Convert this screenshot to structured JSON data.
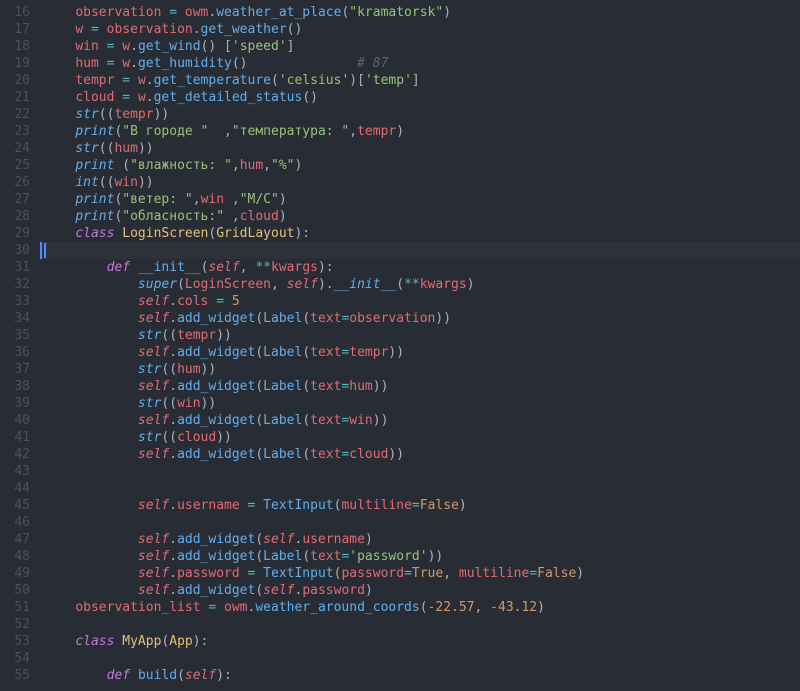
{
  "first_line": 16,
  "highlighted_line": 30,
  "lines": [
    [
      [
        "p",
        "    "
      ],
      [
        "id",
        "observation"
      ],
      [
        "p",
        " "
      ],
      [
        "op",
        "="
      ],
      [
        "p",
        " "
      ],
      [
        "id",
        "owm"
      ],
      [
        "p",
        "."
      ],
      [
        "fn",
        "weather_at_place"
      ],
      [
        "p",
        "("
      ],
      [
        "s",
        "\"kramatorsk\""
      ],
      [
        "p",
        ")"
      ]
    ],
    [
      [
        "p",
        "    "
      ],
      [
        "id",
        "w"
      ],
      [
        "p",
        " "
      ],
      [
        "op",
        "="
      ],
      [
        "p",
        " "
      ],
      [
        "id",
        "observation"
      ],
      [
        "p",
        "."
      ],
      [
        "fn",
        "get_weather"
      ],
      [
        "p",
        "()"
      ]
    ],
    [
      [
        "p",
        "    "
      ],
      [
        "id",
        "win"
      ],
      [
        "p",
        " "
      ],
      [
        "op",
        "="
      ],
      [
        "p",
        " "
      ],
      [
        "id",
        "w"
      ],
      [
        "p",
        "."
      ],
      [
        "fn",
        "get_wind"
      ],
      [
        "p",
        "() ["
      ],
      [
        "s",
        "'speed'"
      ],
      [
        "p",
        "]"
      ]
    ],
    [
      [
        "p",
        "    "
      ],
      [
        "id",
        "hum"
      ],
      [
        "p",
        " "
      ],
      [
        "op",
        "="
      ],
      [
        "p",
        " "
      ],
      [
        "id",
        "w"
      ],
      [
        "p",
        "."
      ],
      [
        "fn",
        "get_humidity"
      ],
      [
        "p",
        "()              "
      ],
      [
        "cm",
        "# 87"
      ]
    ],
    [
      [
        "p",
        "    "
      ],
      [
        "id",
        "tempr"
      ],
      [
        "p",
        " "
      ],
      [
        "op",
        "="
      ],
      [
        "p",
        " "
      ],
      [
        "id",
        "w"
      ],
      [
        "p",
        "."
      ],
      [
        "fn",
        "get_temperature"
      ],
      [
        "p",
        "("
      ],
      [
        "s",
        "'celsius'"
      ],
      [
        "p",
        ")["
      ],
      [
        "s",
        "'temp'"
      ],
      [
        "p",
        "]"
      ]
    ],
    [
      [
        "p",
        "    "
      ],
      [
        "id",
        "cloud"
      ],
      [
        "p",
        " "
      ],
      [
        "op",
        "="
      ],
      [
        "p",
        " "
      ],
      [
        "id",
        "w"
      ],
      [
        "p",
        "."
      ],
      [
        "fn",
        "get_detailed_status"
      ],
      [
        "p",
        "()"
      ]
    ],
    [
      [
        "p",
        "    "
      ],
      [
        "fi",
        "str"
      ],
      [
        "p",
        "(("
      ],
      [
        "id",
        "tempr"
      ],
      [
        "p",
        "))"
      ]
    ],
    [
      [
        "p",
        "    "
      ],
      [
        "fi",
        "print"
      ],
      [
        "p",
        "("
      ],
      [
        "s",
        "\"В городе \"  "
      ],
      [
        "p",
        ","
      ],
      [
        "s",
        "\"температура: \""
      ],
      [
        "p",
        ","
      ],
      [
        "id",
        "tempr"
      ],
      [
        "p",
        ")"
      ]
    ],
    [
      [
        "p",
        "    "
      ],
      [
        "fi",
        "str"
      ],
      [
        "p",
        "(("
      ],
      [
        "id",
        "hum"
      ],
      [
        "p",
        "))"
      ]
    ],
    [
      [
        "p",
        "    "
      ],
      [
        "fi",
        "print"
      ],
      [
        "p",
        " ("
      ],
      [
        "s",
        "\"влажность: \""
      ],
      [
        "p",
        ","
      ],
      [
        "id",
        "hum"
      ],
      [
        "p",
        ","
      ],
      [
        "s",
        "\"%\""
      ],
      [
        "p",
        ")"
      ]
    ],
    [
      [
        "p",
        "    "
      ],
      [
        "fi",
        "int"
      ],
      [
        "p",
        "(("
      ],
      [
        "id",
        "win"
      ],
      [
        "p",
        "))"
      ]
    ],
    [
      [
        "p",
        "    "
      ],
      [
        "fi",
        "print"
      ],
      [
        "p",
        "("
      ],
      [
        "s",
        "\"ветер: \""
      ],
      [
        "p",
        ","
      ],
      [
        "id",
        "win"
      ],
      [
        "p",
        " ,"
      ],
      [
        "s",
        "\"М/С\""
      ],
      [
        "p",
        ")"
      ]
    ],
    [
      [
        "p",
        "    "
      ],
      [
        "fi",
        "print"
      ],
      [
        "p",
        "("
      ],
      [
        "s",
        "\"обласность:\""
      ],
      [
        "p",
        " ,"
      ],
      [
        "id",
        "cloud"
      ],
      [
        "p",
        ")"
      ]
    ],
    [
      [
        "p",
        "    "
      ],
      [
        "k",
        "class"
      ],
      [
        "p",
        " "
      ],
      [
        "cl",
        "LoginScreen"
      ],
      [
        "p",
        "("
      ],
      [
        "cl",
        "GridLayout"
      ],
      [
        "p",
        "):"
      ]
    ],
    [],
    [
      [
        "p",
        "        "
      ],
      [
        "k",
        "def"
      ],
      [
        "p",
        " "
      ],
      [
        "fn",
        "__init__"
      ],
      [
        "p",
        "("
      ],
      [
        "sf",
        "self"
      ],
      [
        "p",
        ", "
      ],
      [
        "op",
        "**"
      ],
      [
        "id",
        "kwargs"
      ],
      [
        "p",
        "):"
      ]
    ],
    [
      [
        "p",
        "            "
      ],
      [
        "fi",
        "super"
      ],
      [
        "p",
        "("
      ],
      [
        "id",
        "LoginScreen"
      ],
      [
        "p",
        ", "
      ],
      [
        "sf",
        "self"
      ],
      [
        "p",
        ")."
      ],
      [
        "fi",
        "__init__"
      ],
      [
        "p",
        "("
      ],
      [
        "op",
        "**"
      ],
      [
        "id",
        "kwargs"
      ],
      [
        "p",
        ")"
      ]
    ],
    [
      [
        "p",
        "            "
      ],
      [
        "sf",
        "self"
      ],
      [
        "p",
        "."
      ],
      [
        "id",
        "cols"
      ],
      [
        "p",
        " "
      ],
      [
        "op",
        "="
      ],
      [
        "p",
        " "
      ],
      [
        "n",
        "5"
      ]
    ],
    [
      [
        "p",
        "            "
      ],
      [
        "sf",
        "self"
      ],
      [
        "p",
        "."
      ],
      [
        "fn",
        "add_widget"
      ],
      [
        "p",
        "("
      ],
      [
        "fn",
        "Label"
      ],
      [
        "p",
        "("
      ],
      [
        "id",
        "text"
      ],
      [
        "op",
        "="
      ],
      [
        "id",
        "observation"
      ],
      [
        "p",
        "))"
      ]
    ],
    [
      [
        "p",
        "            "
      ],
      [
        "fi",
        "str"
      ],
      [
        "p",
        "(("
      ],
      [
        "id",
        "tempr"
      ],
      [
        "p",
        "))"
      ]
    ],
    [
      [
        "p",
        "            "
      ],
      [
        "sf",
        "self"
      ],
      [
        "p",
        "."
      ],
      [
        "fn",
        "add_widget"
      ],
      [
        "p",
        "("
      ],
      [
        "fn",
        "Label"
      ],
      [
        "p",
        "("
      ],
      [
        "id",
        "text"
      ],
      [
        "op",
        "="
      ],
      [
        "id",
        "tempr"
      ],
      [
        "p",
        "))"
      ]
    ],
    [
      [
        "p",
        "            "
      ],
      [
        "fi",
        "str"
      ],
      [
        "p",
        "(("
      ],
      [
        "id",
        "hum"
      ],
      [
        "p",
        "))"
      ]
    ],
    [
      [
        "p",
        "            "
      ],
      [
        "sf",
        "self"
      ],
      [
        "p",
        "."
      ],
      [
        "fn",
        "add_widget"
      ],
      [
        "p",
        "("
      ],
      [
        "fn",
        "Label"
      ],
      [
        "p",
        "("
      ],
      [
        "id",
        "text"
      ],
      [
        "op",
        "="
      ],
      [
        "id",
        "hum"
      ],
      [
        "p",
        "))"
      ]
    ],
    [
      [
        "p",
        "            "
      ],
      [
        "fi",
        "str"
      ],
      [
        "p",
        "(("
      ],
      [
        "id",
        "win"
      ],
      [
        "p",
        "))"
      ]
    ],
    [
      [
        "p",
        "            "
      ],
      [
        "sf",
        "self"
      ],
      [
        "p",
        "."
      ],
      [
        "fn",
        "add_widget"
      ],
      [
        "p",
        "("
      ],
      [
        "fn",
        "Label"
      ],
      [
        "p",
        "("
      ],
      [
        "id",
        "text"
      ],
      [
        "op",
        "="
      ],
      [
        "id",
        "win"
      ],
      [
        "p",
        "))"
      ]
    ],
    [
      [
        "p",
        "            "
      ],
      [
        "fi",
        "str"
      ],
      [
        "p",
        "(("
      ],
      [
        "id",
        "cloud"
      ],
      [
        "p",
        "))"
      ]
    ],
    [
      [
        "p",
        "            "
      ],
      [
        "sf",
        "self"
      ],
      [
        "p",
        "."
      ],
      [
        "fn",
        "add_widget"
      ],
      [
        "p",
        "("
      ],
      [
        "fn",
        "Label"
      ],
      [
        "p",
        "("
      ],
      [
        "id",
        "text"
      ],
      [
        "op",
        "="
      ],
      [
        "id",
        "cloud"
      ],
      [
        "p",
        "))"
      ]
    ],
    [],
    [],
    [
      [
        "p",
        "            "
      ],
      [
        "sf",
        "self"
      ],
      [
        "p",
        "."
      ],
      [
        "id",
        "username"
      ],
      [
        "p",
        " "
      ],
      [
        "op",
        "="
      ],
      [
        "p",
        " "
      ],
      [
        "fn",
        "TextInput"
      ],
      [
        "p",
        "("
      ],
      [
        "id",
        "multiline"
      ],
      [
        "op",
        "="
      ],
      [
        "co",
        "False"
      ],
      [
        "p",
        ")"
      ]
    ],
    [],
    [
      [
        "p",
        "            "
      ],
      [
        "sf",
        "self"
      ],
      [
        "p",
        "."
      ],
      [
        "fn",
        "add_widget"
      ],
      [
        "p",
        "("
      ],
      [
        "sf",
        "self"
      ],
      [
        "p",
        "."
      ],
      [
        "id",
        "username"
      ],
      [
        "p",
        ")"
      ]
    ],
    [
      [
        "p",
        "            "
      ],
      [
        "sf",
        "self"
      ],
      [
        "p",
        "."
      ],
      [
        "fn",
        "add_widget"
      ],
      [
        "p",
        "("
      ],
      [
        "fn",
        "Label"
      ],
      [
        "p",
        "("
      ],
      [
        "id",
        "text"
      ],
      [
        "op",
        "="
      ],
      [
        "s",
        "'password'"
      ],
      [
        "p",
        "))"
      ]
    ],
    [
      [
        "p",
        "            "
      ],
      [
        "sf",
        "self"
      ],
      [
        "p",
        "."
      ],
      [
        "id",
        "password"
      ],
      [
        "p",
        " "
      ],
      [
        "op",
        "="
      ],
      [
        "p",
        " "
      ],
      [
        "fn",
        "TextInput"
      ],
      [
        "p",
        "("
      ],
      [
        "id",
        "password"
      ],
      [
        "op",
        "="
      ],
      [
        "co",
        "True"
      ],
      [
        "p",
        ", "
      ],
      [
        "id",
        "multiline"
      ],
      [
        "op",
        "="
      ],
      [
        "co",
        "False"
      ],
      [
        "p",
        ")"
      ]
    ],
    [
      [
        "p",
        "            "
      ],
      [
        "sf",
        "self"
      ],
      [
        "p",
        "."
      ],
      [
        "fn",
        "add_widget"
      ],
      [
        "p",
        "("
      ],
      [
        "sf",
        "self"
      ],
      [
        "p",
        "."
      ],
      [
        "id",
        "password"
      ],
      [
        "p",
        ")"
      ]
    ],
    [
      [
        "p",
        "    "
      ],
      [
        "id",
        "observation_list"
      ],
      [
        "p",
        " "
      ],
      [
        "op",
        "="
      ],
      [
        "p",
        " "
      ],
      [
        "id",
        "owm"
      ],
      [
        "p",
        "."
      ],
      [
        "fn",
        "weather_around_coords"
      ],
      [
        "p",
        "("
      ],
      [
        "op",
        "-"
      ],
      [
        "n",
        "22.57"
      ],
      [
        "p",
        ", "
      ],
      [
        "op",
        "-"
      ],
      [
        "n",
        "43.12"
      ],
      [
        "p",
        ")"
      ]
    ],
    [],
    [
      [
        "p",
        "    "
      ],
      [
        "k",
        "class"
      ],
      [
        "p",
        " "
      ],
      [
        "cl",
        "MyApp"
      ],
      [
        "p",
        "("
      ],
      [
        "cl",
        "App"
      ],
      [
        "p",
        "):"
      ]
    ],
    [],
    [
      [
        "p",
        "        "
      ],
      [
        "k",
        "def"
      ],
      [
        "p",
        " "
      ],
      [
        "fn",
        "build"
      ],
      [
        "p",
        "("
      ],
      [
        "sf",
        "self"
      ],
      [
        "p",
        "):"
      ]
    ]
  ]
}
